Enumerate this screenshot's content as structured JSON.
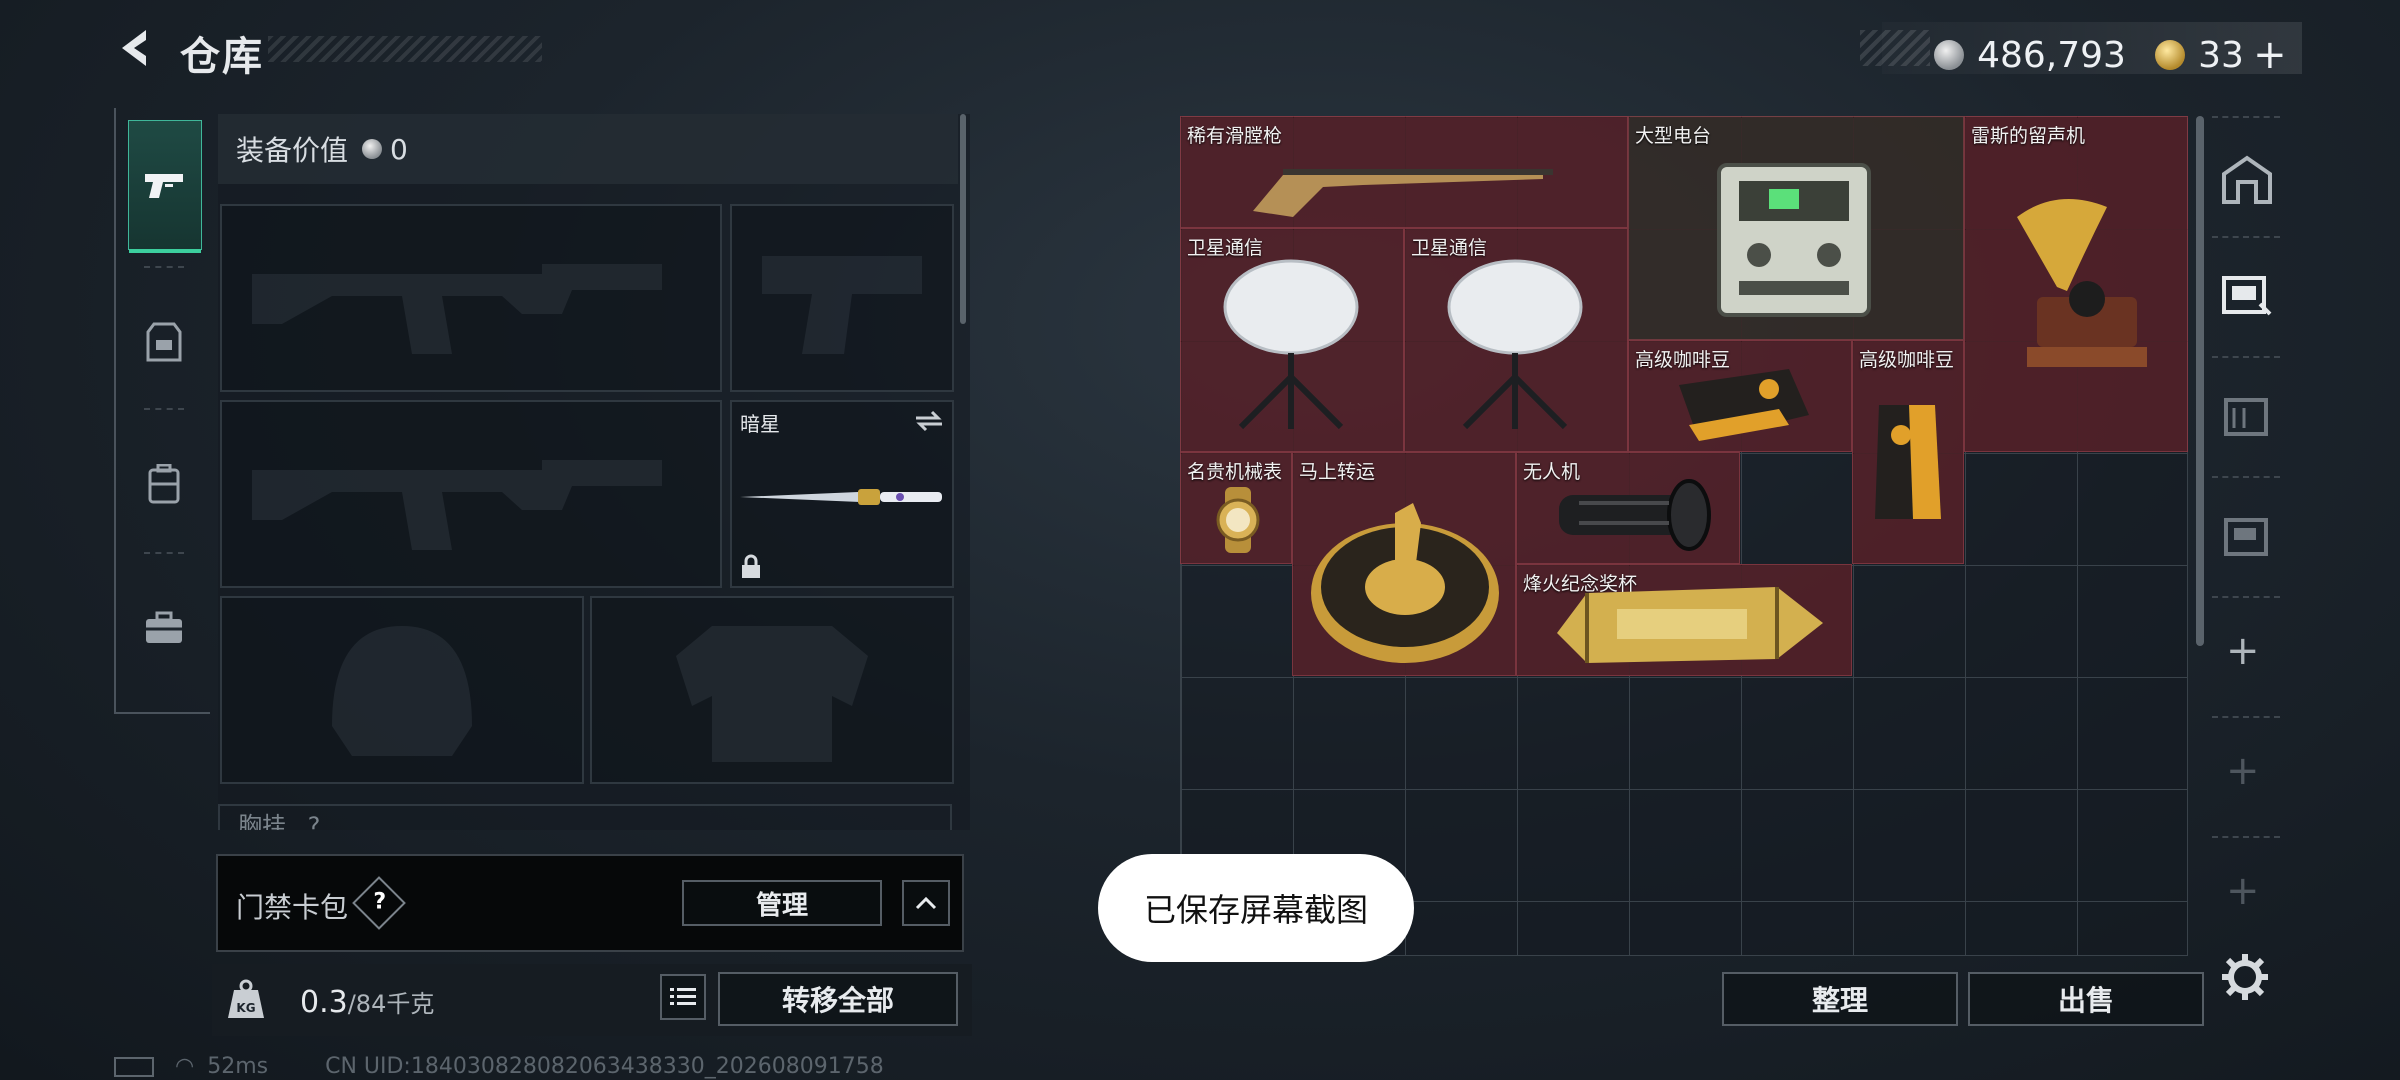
{
  "header": {
    "title": "仓库",
    "currency_silver": "486,793",
    "currency_gold": "33"
  },
  "loadout": {
    "value_label": "装备价值",
    "value_amount": "0",
    "melee_name": "暗星",
    "chest_label": "胸挂",
    "chest_count": "?"
  },
  "card_pack": {
    "label": "门禁卡包",
    "help": "?",
    "manage": "管理"
  },
  "weight": {
    "current": "0.3",
    "max": "/84千克",
    "kg_label": "KG",
    "transfer_all": "转移全部"
  },
  "storage": {
    "items": [
      {
        "name": "稀有滑膛枪"
      },
      {
        "name": "大型电台"
      },
      {
        "name": "雷斯的留声机"
      },
      {
        "name": "卫星通信"
      },
      {
        "name": "卫星通信"
      },
      {
        "name": "高级咖啡豆"
      },
      {
        "name": "高级咖啡豆"
      },
      {
        "name": "名贵机械表"
      },
      {
        "name": "马上转运"
      },
      {
        "name": "无人机"
      },
      {
        "name": "烽火纪念奖杯"
      }
    ],
    "sort": "整理",
    "sell": "出售"
  },
  "toast": "已保存屏幕截图",
  "status": {
    "ping": "52ms",
    "uid": "CN UID:184030828082063438330_202608091758"
  },
  "colors": {
    "accent": "#3ccf9e",
    "item_bg": "#6e222a"
  }
}
